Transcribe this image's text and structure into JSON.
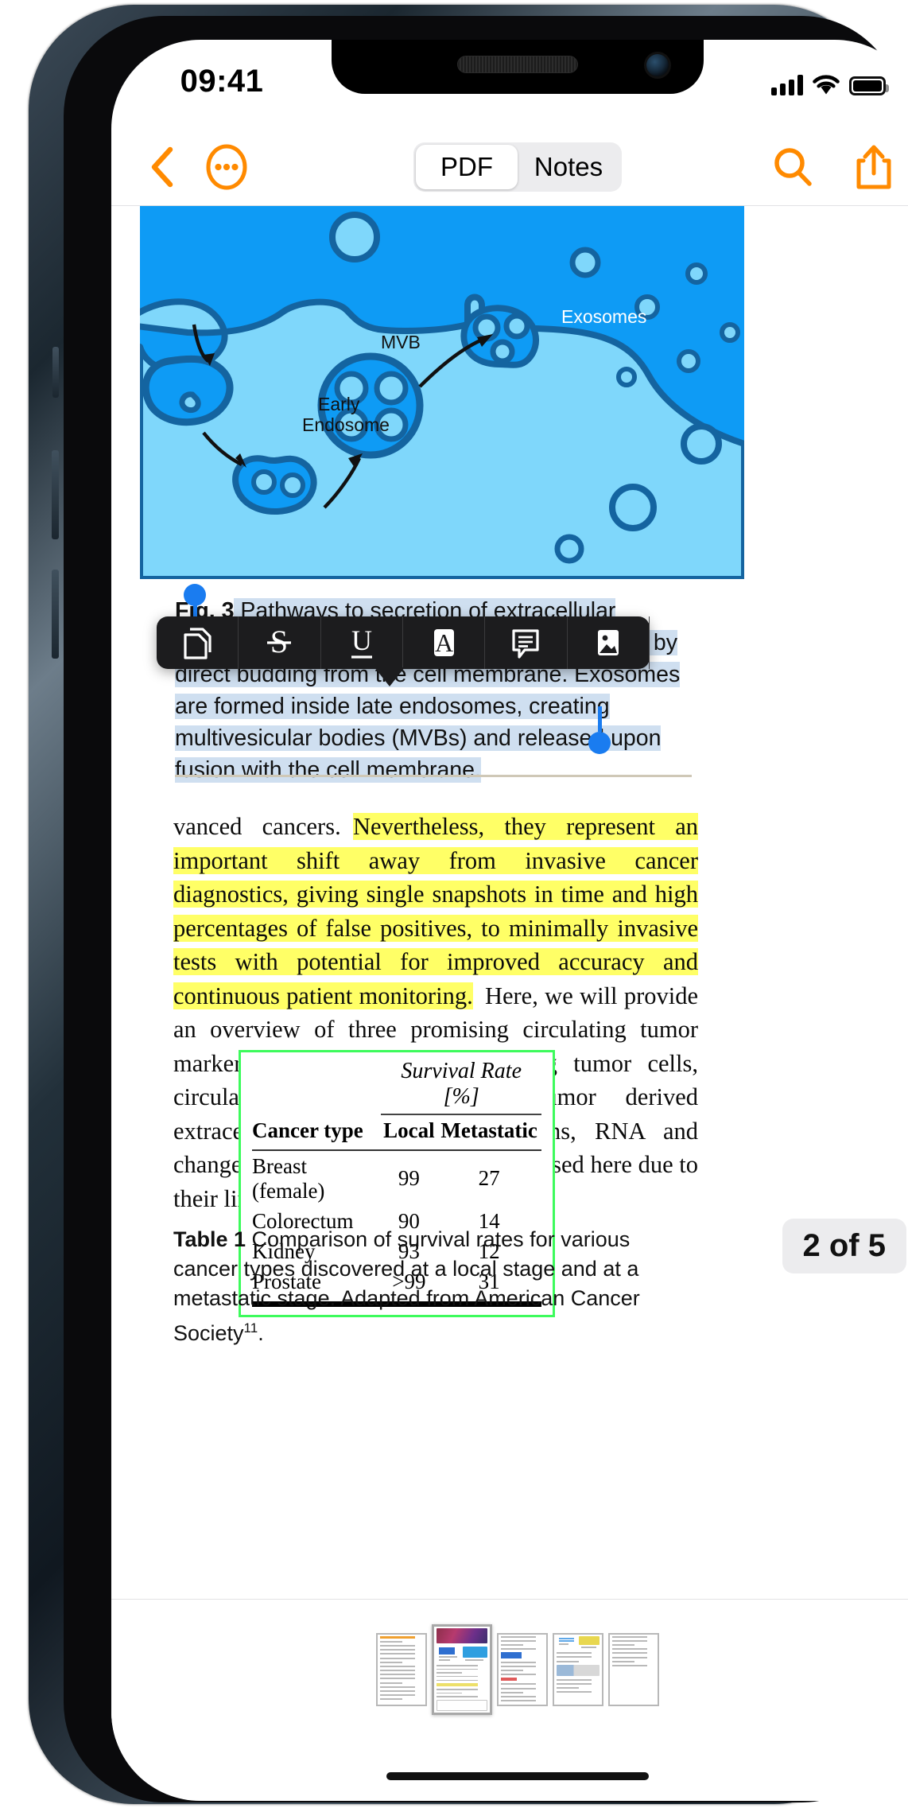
{
  "status_bar": {
    "time": "09:41",
    "signal": "cellular-signal-icon",
    "wifi": "wifi-icon",
    "battery": "battery-icon"
  },
  "toolbar": {
    "back": "back-chevron-icon",
    "more": "more-circle-icon",
    "segments": [
      {
        "label": "PDF",
        "selected": true
      },
      {
        "label": "Notes",
        "selected": false
      }
    ],
    "search": "search-icon",
    "share": "share-icon",
    "accent_color": "#FF8A00"
  },
  "annotation_toolbar": {
    "items": [
      {
        "name": "copy-icon",
        "label": "Copy"
      },
      {
        "name": "strikethrough-icon",
        "label": "S"
      },
      {
        "name": "underline-icon",
        "label": "U"
      },
      {
        "name": "highlight-icon",
        "label": "A"
      },
      {
        "name": "note-icon",
        "label": "Note"
      },
      {
        "name": "image-icon",
        "label": "Image"
      }
    ],
    "background": "#1C1C1E"
  },
  "figure": {
    "labels": {
      "exosomes": "Exosomes",
      "mvb": "MVB",
      "early_endosome_line1": "Early",
      "early_endosome_line2": "Endosome"
    },
    "colors": {
      "outside": "#0E9BF5",
      "cytoplasm": "#7FD7FB",
      "membrane": "#1464A0",
      "vesicle": "#0E9BF5"
    }
  },
  "caption": {
    "label": "Fig.  3",
    "text": " Pathways to secretion of extracellular vesicles from a cell. Microvesicles are secreted by direct budding from the cell membrane. Exosomes are formed inside late endosomes, creating multivesicular bodies (MVBs) and released upon fusion with the cell membrane.",
    "selection_color": "#CFDFF0",
    "handle_color": "#1A7CF0"
  },
  "paragraph": {
    "pre": "vanced cancers. ",
    "highlighted": "Nevertheless, they represent an important shift away from invasive cancer diagnostics, giving single snapshots in time and high percentages of false positives, to minimally invasive tests with potential for improved accuracy and continuous patient monitoring.",
    "post": " Here, we will provide an overview of three promising circulating tumor markers found in blood: circulating tumor cells, circulating tumor DNA and tumor derived extracellular vesicles (EVs). Proteins, RNA and changes to immune cells are not discussed here due to their limited use.",
    "highlight_color": "#FFFF66"
  },
  "table": {
    "spanning_header": "Survival Rate [%]",
    "columns": [
      "Cancer type",
      "Local",
      "Metastatic"
    ],
    "rows": [
      [
        "Breast (female)",
        "99",
        "27"
      ],
      [
        "Colorectum",
        "90",
        "14"
      ],
      [
        "Kidney",
        "93",
        "12"
      ],
      [
        "Prostate",
        ">99",
        "31"
      ]
    ],
    "border_color": "#3DFB5C"
  },
  "table_caption": {
    "label": "Table 1",
    "text": " Comparison of survival rates for various cancer types discovered at a local stage and at a metastatic stage. Adapted from American Cancer Society",
    "footnote": "11",
    "suffix": "."
  },
  "page_indicator": {
    "text": "2 of 5",
    "current": 2,
    "total": 5
  },
  "thumbnails": [
    {
      "name": "page-thumbnail-1",
      "current": false
    },
    {
      "name": "page-thumbnail-2",
      "current": true
    },
    {
      "name": "page-thumbnail-3",
      "current": false
    },
    {
      "name": "page-thumbnail-4",
      "current": false
    },
    {
      "name": "page-thumbnail-5",
      "current": false
    }
  ]
}
